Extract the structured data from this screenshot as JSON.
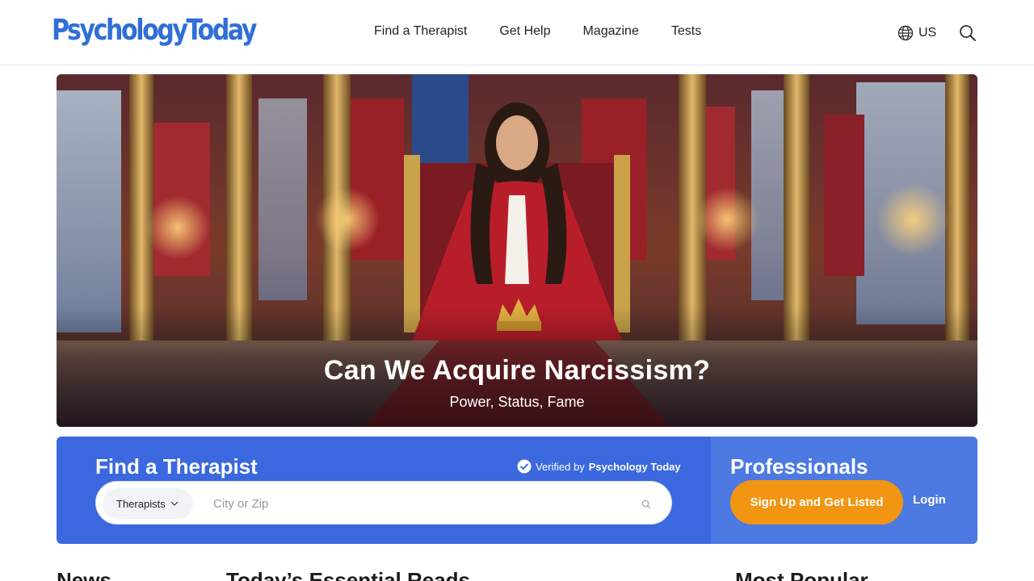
{
  "header": {
    "logo": "PsychologyToday",
    "nav": [
      "Find a Therapist",
      "Get Help",
      "Magazine",
      "Tests"
    ],
    "locale": "US",
    "icons": {
      "locale": "globe-icon",
      "search": "search-icon"
    }
  },
  "hero": {
    "title": "Can We Acquire Narcissism?",
    "subtitle": "Power, Status, Fame"
  },
  "finder": {
    "title": "Find a Therapist",
    "verified_prefix": "Verified by",
    "verified_brand": "Psychology Today",
    "type_selected": "Therapists",
    "city_placeholder": "City or Zip"
  },
  "professionals": {
    "title": "Professionals",
    "signup_label": "Sign Up and Get Listed",
    "login_label": "Login"
  },
  "sections": {
    "news": "News",
    "essential": "Today’s Essential Reads",
    "popular": "Most Popular"
  },
  "colors": {
    "brand_blue": "#2f6fd6",
    "finder_bg": "#3b68de",
    "pros_bg": "#4c79e2",
    "cta_orange": "#f29512"
  }
}
